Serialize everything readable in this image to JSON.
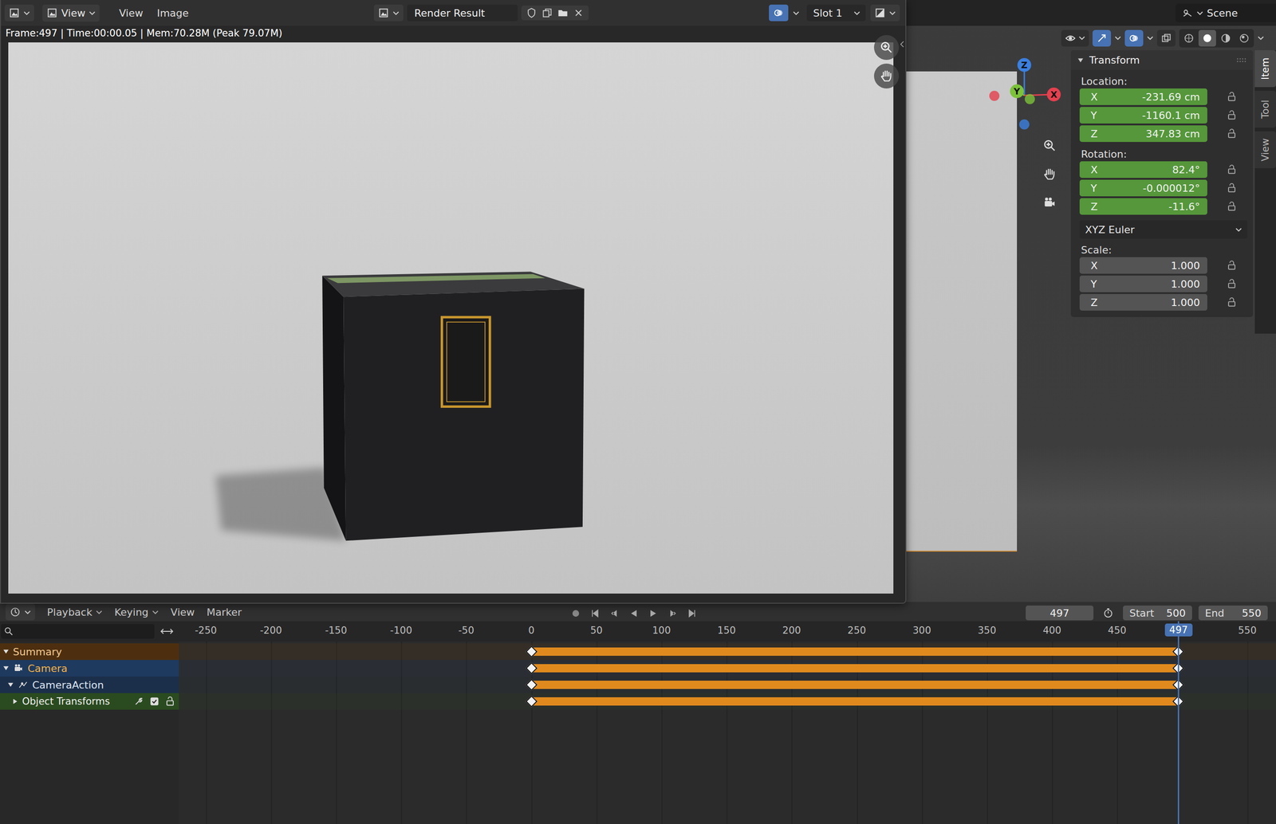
{
  "render_window": {
    "mode": "View",
    "menus": [
      "View",
      "Image"
    ],
    "image_name": "Render Result",
    "slot": "Slot 1",
    "info": "Frame:497 | Time:00:00.05 | Mem:70.28M (Peak 79.07M)"
  },
  "viewport": {
    "scene": "Scene",
    "gizmo_toggle": {
      "on": true
    },
    "overlays": {
      "on": true
    },
    "xray": {
      "on": false
    },
    "shading": [
      {
        "mode": "wireframe",
        "selected": false
      },
      {
        "mode": "solid",
        "selected": true
      },
      {
        "mode": "material",
        "selected": false
      },
      {
        "mode": "rendered",
        "selected": false
      }
    ],
    "axes": [
      {
        "label": "Z",
        "color": "#3b7fe0"
      },
      {
        "label": "Y",
        "color": "#7cc23a"
      },
      {
        "label": "X",
        "color": "#e5404e"
      }
    ]
  },
  "sidebar": {
    "tabs": [
      {
        "label": "Item",
        "selected": true
      },
      {
        "label": "Tool",
        "selected": false
      },
      {
        "label": "View",
        "selected": false
      }
    ],
    "panel": {
      "title": "Transform",
      "expanded": true,
      "groups": [
        {
          "label": "Location:",
          "fields": [
            {
              "axis": "X",
              "value": "-231.69 cm",
              "animated": true,
              "locked": false
            },
            {
              "axis": "Y",
              "value": "-1160.1 cm",
              "animated": true,
              "locked": false
            },
            {
              "axis": "Z",
              "value": "347.83 cm",
              "animated": true,
              "locked": false
            }
          ]
        },
        {
          "label": "Rotation:",
          "fields": [
            {
              "axis": "X",
              "value": "82.4°",
              "animated": true,
              "locked": false
            },
            {
              "axis": "Y",
              "value": "-0.000012°",
              "animated": true,
              "locked": false
            },
            {
              "axis": "Z",
              "value": "-11.6°",
              "animated": true,
              "locked": false
            }
          ],
          "mode": "XYZ Euler"
        },
        {
          "label": "Scale:",
          "fields": [
            {
              "axis": "X",
              "value": "1.000",
              "animated": false,
              "locked": false
            },
            {
              "axis": "Y",
              "value": "1.000",
              "animated": false,
              "locked": false
            },
            {
              "axis": "Z",
              "value": "1.000",
              "animated": false,
              "locked": false
            }
          ]
        }
      ]
    }
  },
  "timeline": {
    "menus": [
      {
        "label": "Playback",
        "dropdown": true
      },
      {
        "label": "Keying",
        "dropdown": true
      },
      {
        "label": "View",
        "dropdown": false
      },
      {
        "label": "Marker",
        "dropdown": false
      }
    ],
    "current_frame": "497",
    "range": [
      {
        "label": "Start",
        "value": "500"
      },
      {
        "label": "End",
        "value": "550"
      }
    ],
    "ruler": [
      "-250",
      "-200",
      "-150",
      "-100",
      "-50",
      "0",
      "50",
      "100",
      "150",
      "200",
      "250",
      "300",
      "350",
      "400",
      "450",
      "550"
    ],
    "channels": [
      {
        "name": "Summary",
        "kind": "summary",
        "expanded": true,
        "keys": [
          0,
          497
        ]
      },
      {
        "name": "Camera",
        "kind": "object",
        "expanded": true,
        "keys": [
          0,
          497
        ]
      },
      {
        "name": "CameraAction",
        "kind": "action",
        "expanded": true,
        "keys": [
          0,
          497
        ]
      },
      {
        "name": "Object Transforms",
        "kind": "group",
        "expanded": false,
        "checked": true,
        "locked": false,
        "keys": [
          0,
          497
        ]
      }
    ]
  }
}
